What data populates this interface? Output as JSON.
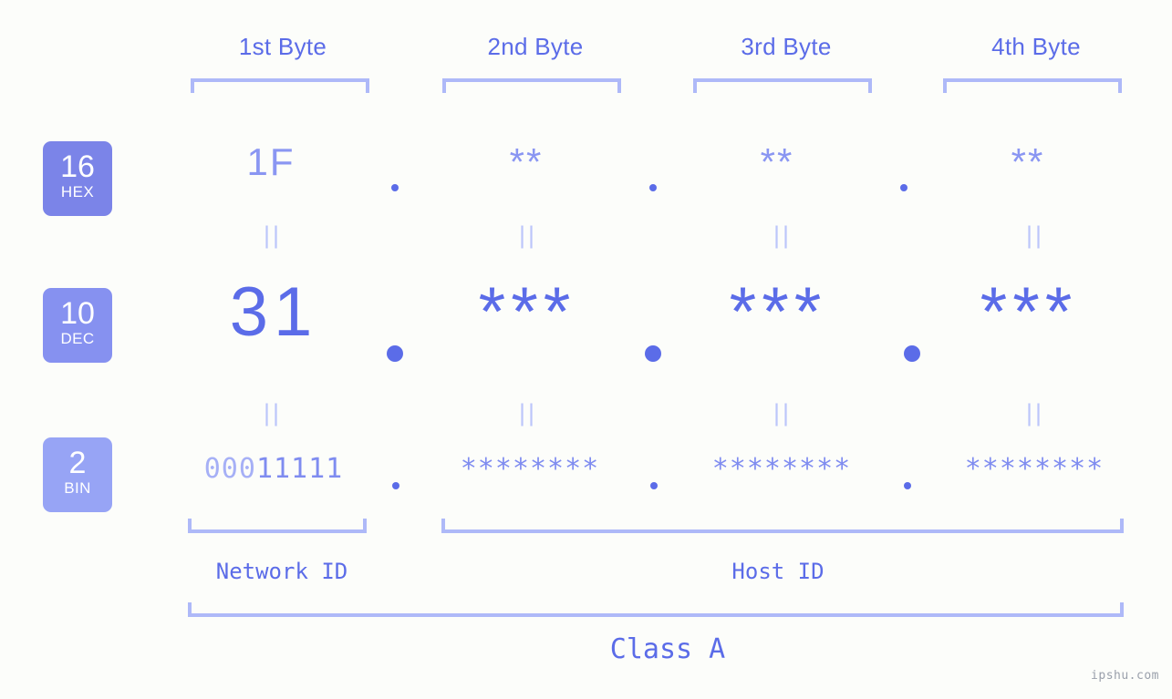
{
  "meta": {
    "watermark": "ipshu.com",
    "background_color": "#fcfdfa",
    "accent_color": "#5b6ce8",
    "accent_light_color": "#aeb9f8"
  },
  "byte_headers": [
    {
      "label": "1st Byte"
    },
    {
      "label": "2nd Byte"
    },
    {
      "label": "3rd Byte"
    },
    {
      "label": "4th Byte"
    }
  ],
  "bases": [
    {
      "number": "16",
      "name": "HEX",
      "color": "#7b84e8"
    },
    {
      "number": "10",
      "name": "DEC",
      "color": "#8691f0"
    },
    {
      "number": "2",
      "name": "BIN",
      "color": "#97a4f5"
    }
  ],
  "rows": {
    "hex": {
      "base_number": "16",
      "base_name": "HEX",
      "values": [
        "1F",
        "**",
        "**",
        "**"
      ],
      "separator": "."
    },
    "dec": {
      "base_number": "10",
      "base_name": "DEC",
      "values": [
        "31",
        "***",
        "***",
        "***"
      ],
      "separator": "."
    },
    "bin": {
      "base_number": "2",
      "base_name": "BIN",
      "values": [
        "00011111",
        "********",
        "********",
        "********"
      ],
      "value1_leading": "000",
      "value1_rest": "11111",
      "separator": "."
    }
  },
  "equals_symbol": "||",
  "segments": {
    "network_id": "Network ID",
    "host_id": "Host ID",
    "class": "Class A"
  }
}
